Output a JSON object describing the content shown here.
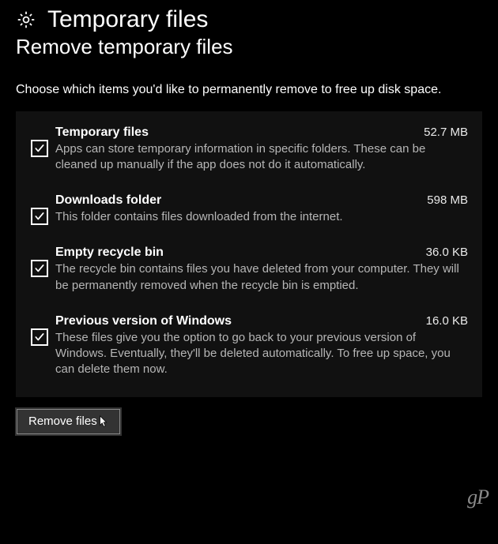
{
  "header": {
    "title": "Temporary files",
    "subtitle": "Remove temporary files"
  },
  "intro": "Choose which items you'd like to permanently remove to free up disk space.",
  "items": [
    {
      "title": "Temporary files",
      "size": "52.7 MB",
      "desc": "Apps can store temporary information in specific folders. These can be cleaned up manually if the app does not do it automatically.",
      "checked": true
    },
    {
      "title": "Downloads folder",
      "size": "598 MB",
      "desc": "This folder contains files downloaded from the internet.",
      "checked": true
    },
    {
      "title": "Empty recycle bin",
      "size": "36.0 KB",
      "desc": "The recycle bin contains files you have deleted from your computer. They will be permanently removed when the recycle bin is emptied.",
      "checked": true
    },
    {
      "title": "Previous version of Windows",
      "size": "16.0 KB",
      "desc": "These files give you the option to go back to your previous version of Windows. Eventually, they'll be deleted automatically. To free up space, you can delete them now.",
      "checked": true
    }
  ],
  "button": {
    "label": "Remove files"
  },
  "watermark": "gP"
}
